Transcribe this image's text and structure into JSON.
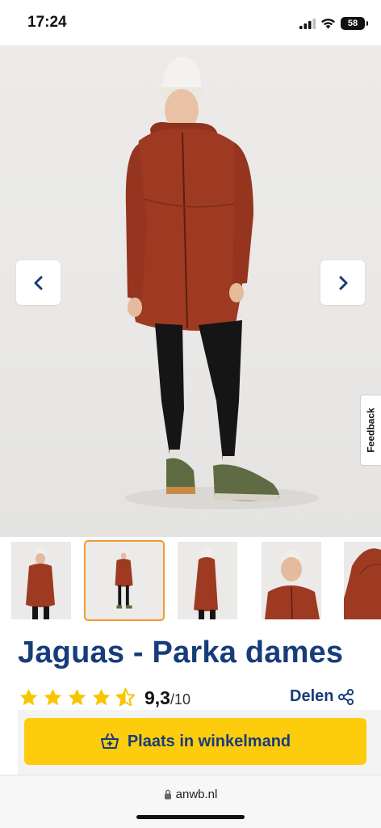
{
  "status_bar": {
    "time": "17:24",
    "battery": "58",
    "icons": [
      "signal-icon",
      "wifi-icon",
      "battery-icon"
    ]
  },
  "gallery": {
    "prev_icon": "chevron-left-icon",
    "next_icon": "chevron-right-icon",
    "active_thumbnail": 1,
    "thumbnail_count": 5
  },
  "feedback": {
    "label": "Feedback"
  },
  "product": {
    "title": "Jaguas - Parka dames",
    "rating": "9,3",
    "rating_max": "/10",
    "stars_filled": 4.5,
    "share_label": "Delen",
    "share_icon": "share-icon"
  },
  "cart": {
    "button_label": "Plaats in winkelmand",
    "icon": "basket-plus-icon"
  },
  "browser": {
    "url": "anwb.nl",
    "lock_icon": "lock-icon"
  },
  "colors": {
    "brand_blue": "#173c7c",
    "cta_yellow": "#fdcc0d",
    "star_yellow": "#f7c600",
    "thumb_active": "#f39a34",
    "parka_red": "#9e3a22"
  }
}
